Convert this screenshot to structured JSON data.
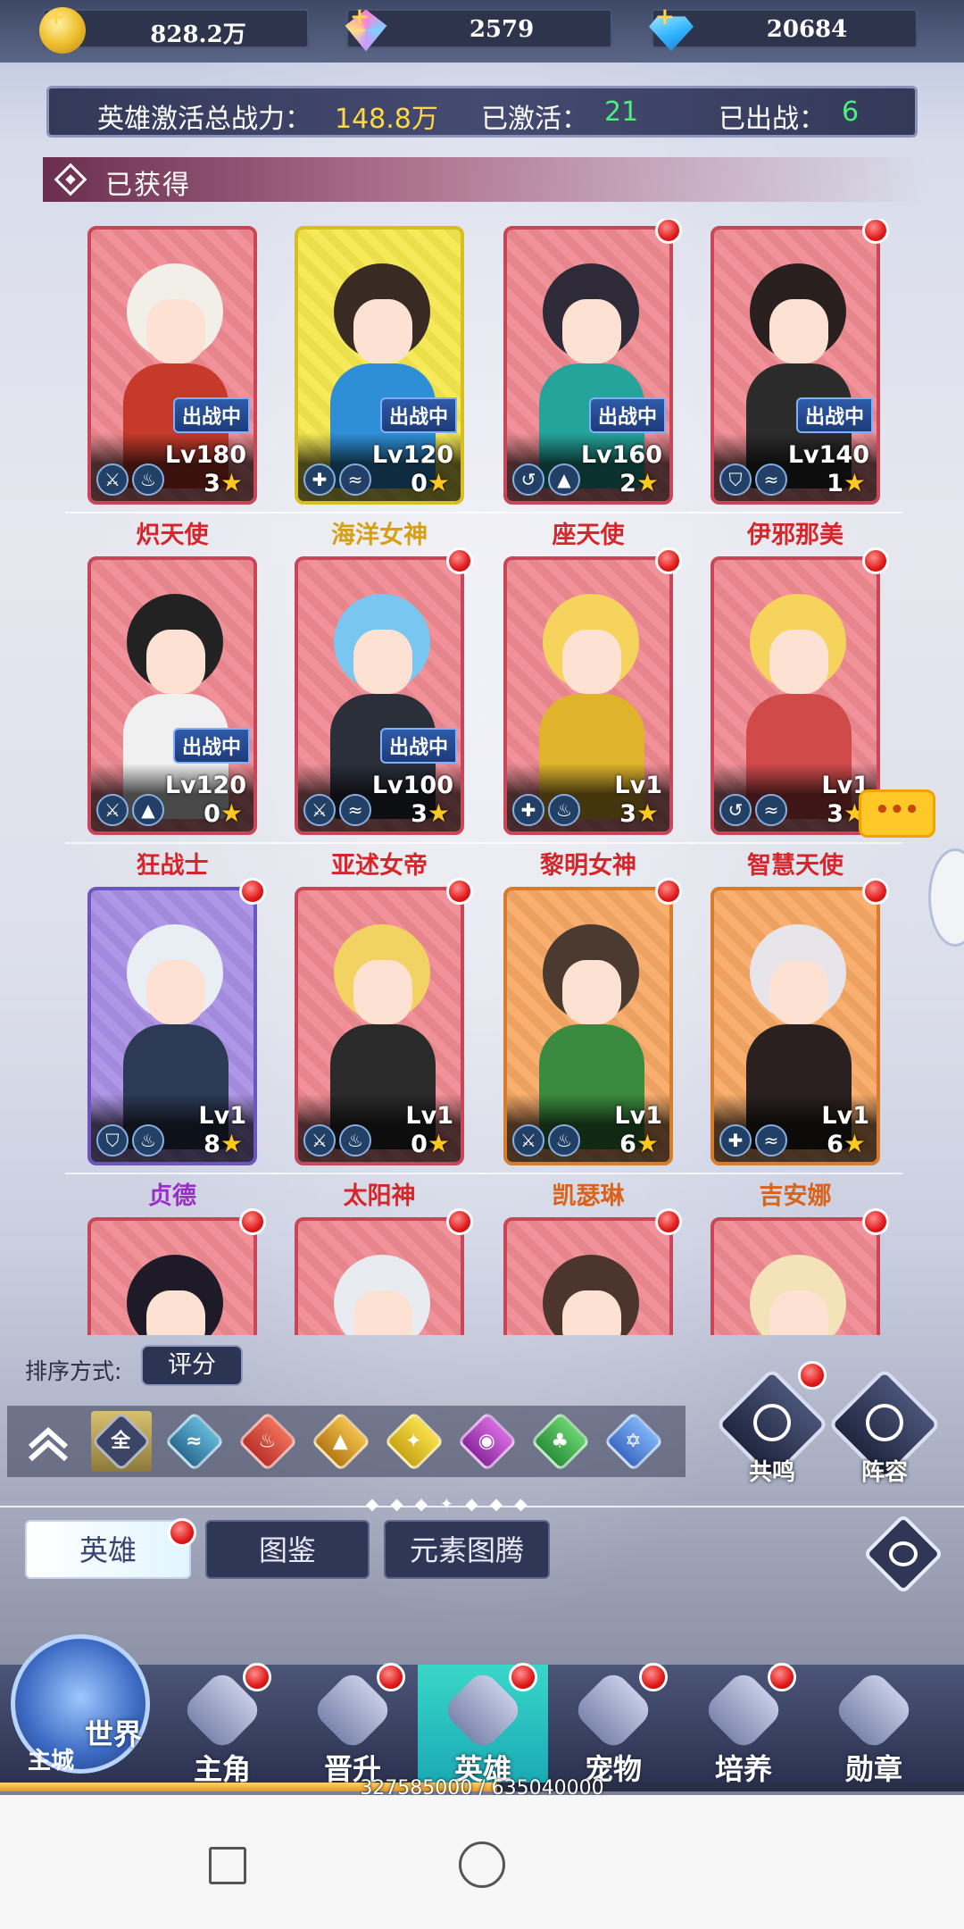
{
  "currency": [
    {
      "icon": "gold-coin-icon",
      "value": "828.2万"
    },
    {
      "icon": "crystal-icon",
      "value": "2579"
    },
    {
      "icon": "diamond-icon",
      "value": "20684"
    }
  ],
  "stats": {
    "power_label": "英雄激活总战力：",
    "power_value": "148.8万",
    "activated_label": "已激活：",
    "activated_value": "21",
    "deployed_label": "已出战：",
    "deployed_value": "6"
  },
  "section_title": "已获得",
  "deploy_badge": "出战中",
  "heroes": [
    {
      "name": "炽天使",
      "level": "Lv180",
      "stars": "3",
      "rarity": "red",
      "deployed": true,
      "dot": false
    },
    {
      "name": "海洋女神",
      "level": "Lv120",
      "stars": "0",
      "rarity": "gold",
      "deployed": true,
      "dot": false
    },
    {
      "name": "座天使",
      "level": "Lv160",
      "stars": "2",
      "rarity": "red",
      "deployed": true,
      "dot": true
    },
    {
      "name": "伊邪那美",
      "level": "Lv140",
      "stars": "1",
      "rarity": "red",
      "deployed": true,
      "dot": true
    },
    {
      "name": "狂战士",
      "level": "Lv120",
      "stars": "0",
      "rarity": "red",
      "deployed": true,
      "dot": false
    },
    {
      "name": "亚述女帝",
      "level": "Lv100",
      "stars": "3",
      "rarity": "red",
      "deployed": true,
      "dot": true
    },
    {
      "name": "黎明女神",
      "level": "Lv1",
      "stars": "3",
      "rarity": "red",
      "deployed": false,
      "dot": true
    },
    {
      "name": "智慧天使",
      "level": "Lv1",
      "stars": "3",
      "rarity": "red",
      "deployed": false,
      "dot": true
    },
    {
      "name": "贞德",
      "level": "Lv1",
      "stars": "8",
      "rarity": "purple",
      "deployed": false,
      "dot": true
    },
    {
      "name": "太阳神",
      "level": "Lv1",
      "stars": "0",
      "rarity": "red",
      "deployed": false,
      "dot": true
    },
    {
      "name": "凯瑟琳",
      "level": "Lv1",
      "stars": "6",
      "rarity": "orange",
      "deployed": false,
      "dot": true
    },
    {
      "name": "吉安娜",
      "level": "Lv1",
      "stars": "6",
      "rarity": "orange",
      "deployed": false,
      "dot": true
    }
  ],
  "chat_bubble": "•••",
  "sort": {
    "label": "排序方式:",
    "value": "评分"
  },
  "filter_all": "全",
  "side_buttons": {
    "resonance": "共鸣",
    "lineup": "阵容"
  },
  "tabs": {
    "heroes": "英雄",
    "codex": "图鉴",
    "totem": "元素图腾"
  },
  "nav": {
    "world": "世界",
    "main_city": "主城",
    "protagonist": "主角",
    "promote": "晋升",
    "hero": "英雄",
    "pet": "宠物",
    "train": "培养",
    "medal": "勋章"
  },
  "progress": {
    "text": "327585000 / 635040000",
    "fraction": 0.516
  },
  "colors": {
    "red_dot": "#e01919",
    "active_tab": "#2fc3c0",
    "yellow": "#ffd84a",
    "green": "#4cf07a"
  }
}
